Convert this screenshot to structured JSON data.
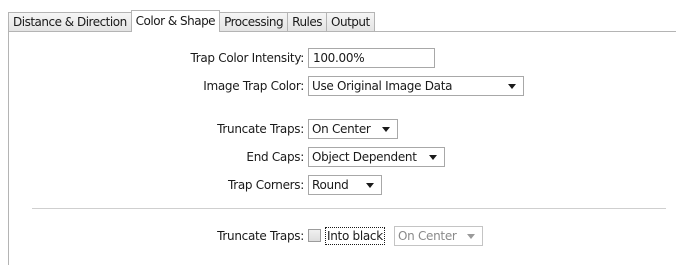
{
  "tabs": [
    {
      "label": "Distance & Direction",
      "active": false
    },
    {
      "label": "Color & Shape",
      "active": true
    },
    {
      "label": "Processing",
      "active": false
    },
    {
      "label": "Rules",
      "active": false
    },
    {
      "label": "Output",
      "active": false
    }
  ],
  "form": {
    "trap_color_intensity": {
      "label": "Trap Color Intensity:",
      "value": "100.00%"
    },
    "image_trap_color": {
      "label": "Image Trap Color:",
      "value": "Use Original Image Data"
    },
    "truncate_traps": {
      "label": "Truncate Traps:",
      "value": "On Center"
    },
    "end_caps": {
      "label": "End Caps:",
      "value": "Object Dependent"
    },
    "trap_corners": {
      "label": "Trap Corners:",
      "value": "Round"
    },
    "truncate_traps_black": {
      "label": "Truncate Traps:",
      "checkbox_label": "Into black",
      "checked": false,
      "value": "On Center",
      "enabled": false
    }
  }
}
